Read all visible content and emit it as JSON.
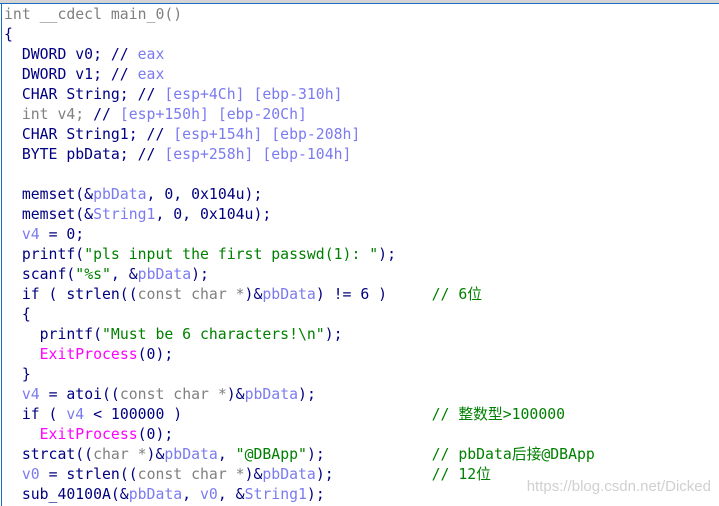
{
  "colors": {
    "keyword": "#000080",
    "type": "#808080",
    "variable": "#7b7bf0",
    "string": "#008000",
    "import": "#ff00ff",
    "comment": "#008000",
    "border": "#1c6cc4"
  },
  "watermark": "https://blog.csdn.net/Dicked",
  "lines": [
    {
      "tokens": [
        [
          "int __cdecl main_0()",
          "t"
        ]
      ]
    },
    {
      "tokens": [
        [
          "{",
          "k"
        ]
      ]
    },
    {
      "tokens": [
        [
          "  DWORD v0; // ",
          "k"
        ],
        [
          "eax",
          "v"
        ]
      ]
    },
    {
      "tokens": [
        [
          "  DWORD v1; // ",
          "k"
        ],
        [
          "eax",
          "v"
        ]
      ]
    },
    {
      "tokens": [
        [
          "  CHAR String; // ",
          "k"
        ],
        [
          "[esp+4Ch] [ebp-310h]",
          "v"
        ]
      ]
    },
    {
      "tokens": [
        [
          "  int v4; ",
          "t"
        ],
        [
          "// ",
          "k"
        ],
        [
          "[esp+150h] [ebp-20Ch]",
          "v"
        ]
      ]
    },
    {
      "tokens": [
        [
          "  CHAR String1; // ",
          "k"
        ],
        [
          "[esp+154h] [ebp-208h]",
          "v"
        ]
      ]
    },
    {
      "tokens": [
        [
          "  BYTE pbData; // ",
          "k"
        ],
        [
          "[esp+258h] [ebp-104h]",
          "v"
        ]
      ]
    },
    {
      "tokens": []
    },
    {
      "tokens": [
        [
          "  memset(&",
          "k"
        ],
        [
          "pbData",
          "v"
        ],
        [
          ", 0, 0x104u);",
          "k"
        ]
      ]
    },
    {
      "tokens": [
        [
          "  memset(&",
          "k"
        ],
        [
          "String1",
          "v"
        ],
        [
          ", 0, 0x104u);",
          "k"
        ]
      ]
    },
    {
      "tokens": [
        [
          "  ",
          "k"
        ],
        [
          "v4",
          "v"
        ],
        [
          " = 0;",
          "k"
        ]
      ]
    },
    {
      "tokens": [
        [
          "  printf(",
          "k"
        ],
        [
          "\"pls input the first passwd(1): \"",
          "s"
        ],
        [
          ");",
          "k"
        ]
      ]
    },
    {
      "tokens": [
        [
          "  scanf(",
          "k"
        ],
        [
          "\"%s\"",
          "s"
        ],
        [
          ", &",
          "k"
        ],
        [
          "pbData",
          "v"
        ],
        [
          ");",
          "k"
        ]
      ]
    },
    {
      "tokens": [
        [
          "  if ( strlen((",
          "k"
        ],
        [
          "const char *",
          "t"
        ],
        [
          ")&",
          "k"
        ],
        [
          "pbData",
          "v"
        ],
        [
          ") != 6 )",
          "k"
        ]
      ],
      "comment": "// 6位"
    },
    {
      "tokens": [
        [
          "  {",
          "k"
        ]
      ]
    },
    {
      "tokens": [
        [
          "    printf(",
          "k"
        ],
        [
          "\"Must be 6 characters!\\n\"",
          "s"
        ],
        [
          ");",
          "k"
        ]
      ]
    },
    {
      "tokens": [
        [
          "    ",
          "k"
        ],
        [
          "ExitProcess",
          "m"
        ],
        [
          "(0);",
          "k"
        ]
      ]
    },
    {
      "tokens": [
        [
          "  }",
          "k"
        ]
      ]
    },
    {
      "tokens": [
        [
          "  ",
          "k"
        ],
        [
          "v4",
          "v"
        ],
        [
          " = atoi((",
          "k"
        ],
        [
          "const char *",
          "t"
        ],
        [
          ")&",
          "k"
        ],
        [
          "pbData",
          "v"
        ],
        [
          ");",
          "k"
        ]
      ]
    },
    {
      "tokens": [
        [
          "  if ( ",
          "k"
        ],
        [
          "v4",
          "v"
        ],
        [
          " < 100000 )",
          "k"
        ]
      ],
      "comment": "// 整数型>100000"
    },
    {
      "tokens": [
        [
          "    ",
          "k"
        ],
        [
          "ExitProcess",
          "m"
        ],
        [
          "(0);",
          "k"
        ]
      ]
    },
    {
      "tokens": [
        [
          "  strcat((",
          "k"
        ],
        [
          "char *",
          "t"
        ],
        [
          ")&",
          "k"
        ],
        [
          "pbData",
          "v"
        ],
        [
          ", ",
          "k"
        ],
        [
          "\"@DBApp\"",
          "s"
        ],
        [
          ");",
          "k"
        ]
      ],
      "comment": "// pbData后接@DBApp"
    },
    {
      "tokens": [
        [
          "  ",
          "k"
        ],
        [
          "v0",
          "v"
        ],
        [
          " = strlen((",
          "k"
        ],
        [
          "const char *",
          "t"
        ],
        [
          ")&",
          "k"
        ],
        [
          "pbData",
          "v"
        ],
        [
          ");",
          "k"
        ]
      ],
      "comment": "// 12位"
    },
    {
      "tokens": [
        [
          "  sub_40100A(&",
          "k"
        ],
        [
          "pbData",
          "v"
        ],
        [
          ", ",
          "k"
        ],
        [
          "v0",
          "v"
        ],
        [
          ", &",
          "k"
        ],
        [
          "String1",
          "v"
        ],
        [
          ");",
          "k"
        ]
      ]
    }
  ]
}
